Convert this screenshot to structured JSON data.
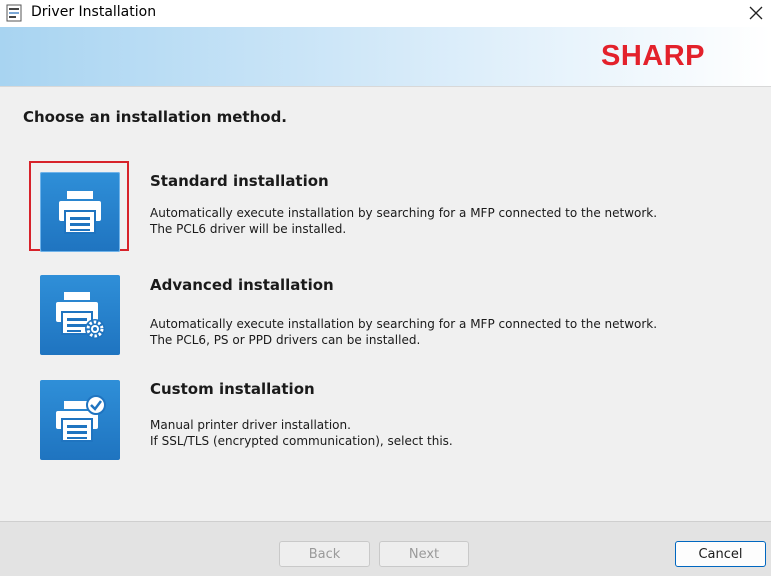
{
  "window": {
    "title": "Driver Installation"
  },
  "banner": {
    "logo_text": "SHARP",
    "logo_color": "#e3212b"
  },
  "main": {
    "prompt": "Choose an installation method.",
    "options": [
      {
        "title": "Standard installation",
        "desc_line1": "Automatically execute installation by searching for a MFP connected to the network.",
        "desc_line2": "The PCL6 driver will be installed.",
        "icon": "printer-icon",
        "selected": true
      },
      {
        "title": "Advanced installation",
        "desc_line1": "Automatically execute installation by searching for a MFP connected to the network.",
        "desc_line2": "The PCL6, PS or PPD drivers can be installed.",
        "icon": "printer-gear-icon",
        "selected": false
      },
      {
        "title": "Custom installation",
        "desc_line1": "Manual printer driver installation.",
        "desc_line2": "If SSL/TLS (encrypted communication), select this.",
        "icon": "printer-check-icon",
        "selected": false
      }
    ]
  },
  "footer": {
    "back_label": "Back",
    "next_label": "Next",
    "cancel_label": "Cancel"
  },
  "colors": {
    "accent_blue": "#1f74c0",
    "selection_red": "#d7222a"
  }
}
